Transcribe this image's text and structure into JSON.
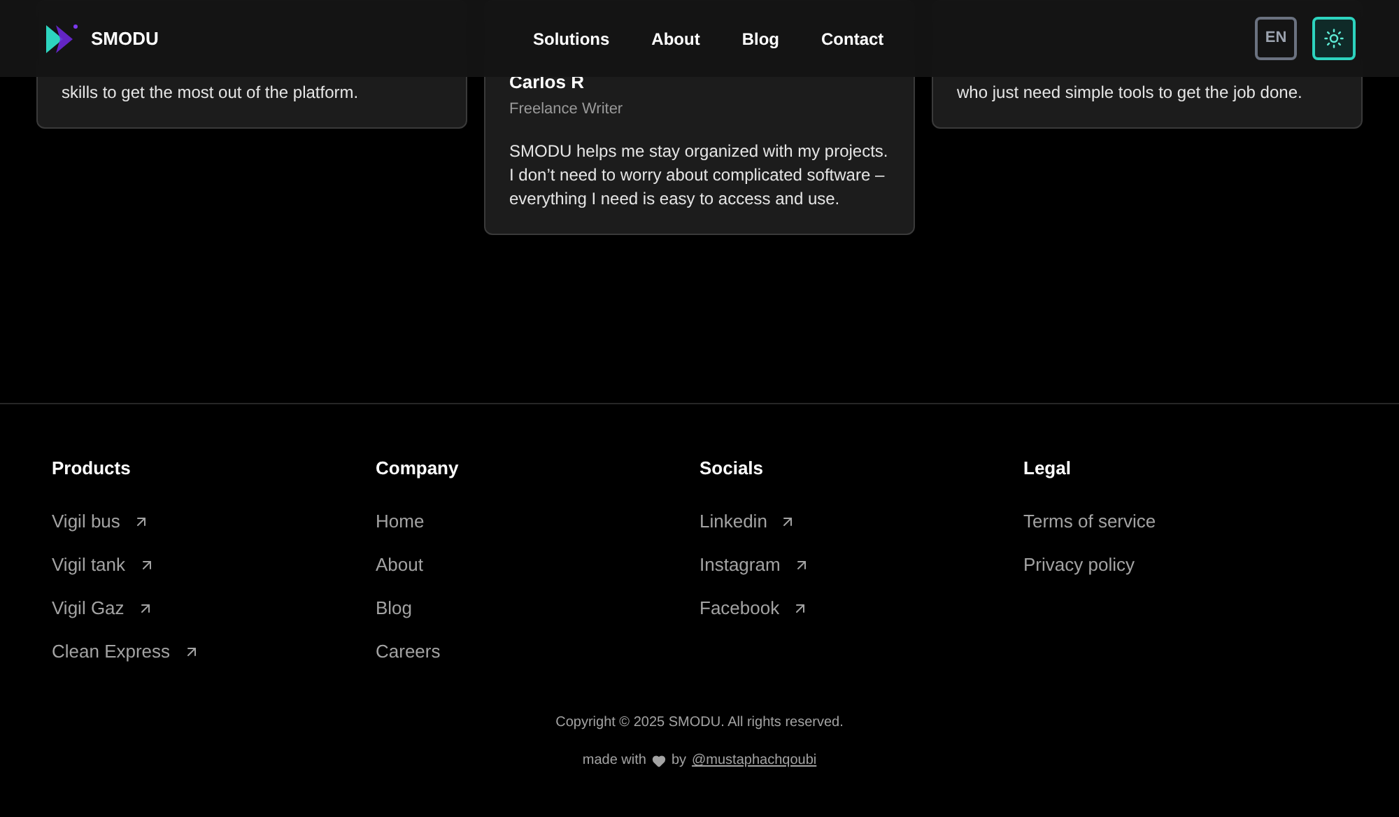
{
  "header": {
    "brand": "SMODU",
    "nav": [
      {
        "label": "Solutions",
        "selected": false
      },
      {
        "label": "About",
        "selected": false
      },
      {
        "label": "Blog",
        "selected": false
      },
      {
        "label": "Contact",
        "selected": false
      }
    ],
    "language": "EN",
    "theme_toggle": {
      "on": true
    }
  },
  "testimonials": [
    {
      "text": "skills to get the most out of the platform."
    },
    {
      "name": "Carlos R",
      "role": "Freelance Writer",
      "text": "SMODU helps me stay organized with my projects. I don’t need to worry about complicated software – everything I need is easy to access and use."
    },
    {
      "text": "who just need simple tools to get the job done."
    }
  ],
  "footer": {
    "columns": [
      {
        "title": "Products",
        "links": [
          {
            "label": "Vigil bus",
            "external": true
          },
          {
            "label": "Vigil tank",
            "external": true
          },
          {
            "label": "Vigil Gaz",
            "external": true
          },
          {
            "label": "Clean Express",
            "external": true
          }
        ]
      },
      {
        "title": "Company",
        "links": [
          {
            "label": "Home",
            "external": false
          },
          {
            "label": "About",
            "external": false
          },
          {
            "label": "Blog",
            "external": false
          },
          {
            "label": "Careers",
            "external": false
          }
        ]
      },
      {
        "title": "Socials",
        "links": [
          {
            "label": "Linkedin",
            "external": true
          },
          {
            "label": "Instagram",
            "external": true
          },
          {
            "label": "Facebook",
            "external": true
          }
        ]
      },
      {
        "title": "Legal",
        "links": [
          {
            "label": "Terms of service",
            "external": false
          },
          {
            "label": "Privacy policy",
            "external": false
          }
        ]
      }
    ],
    "copyright": "Copyright © 2025 SMODU. All rights reserved.",
    "made_with": "made with",
    "by": "by",
    "author": "@mustaphachqoubi"
  }
}
